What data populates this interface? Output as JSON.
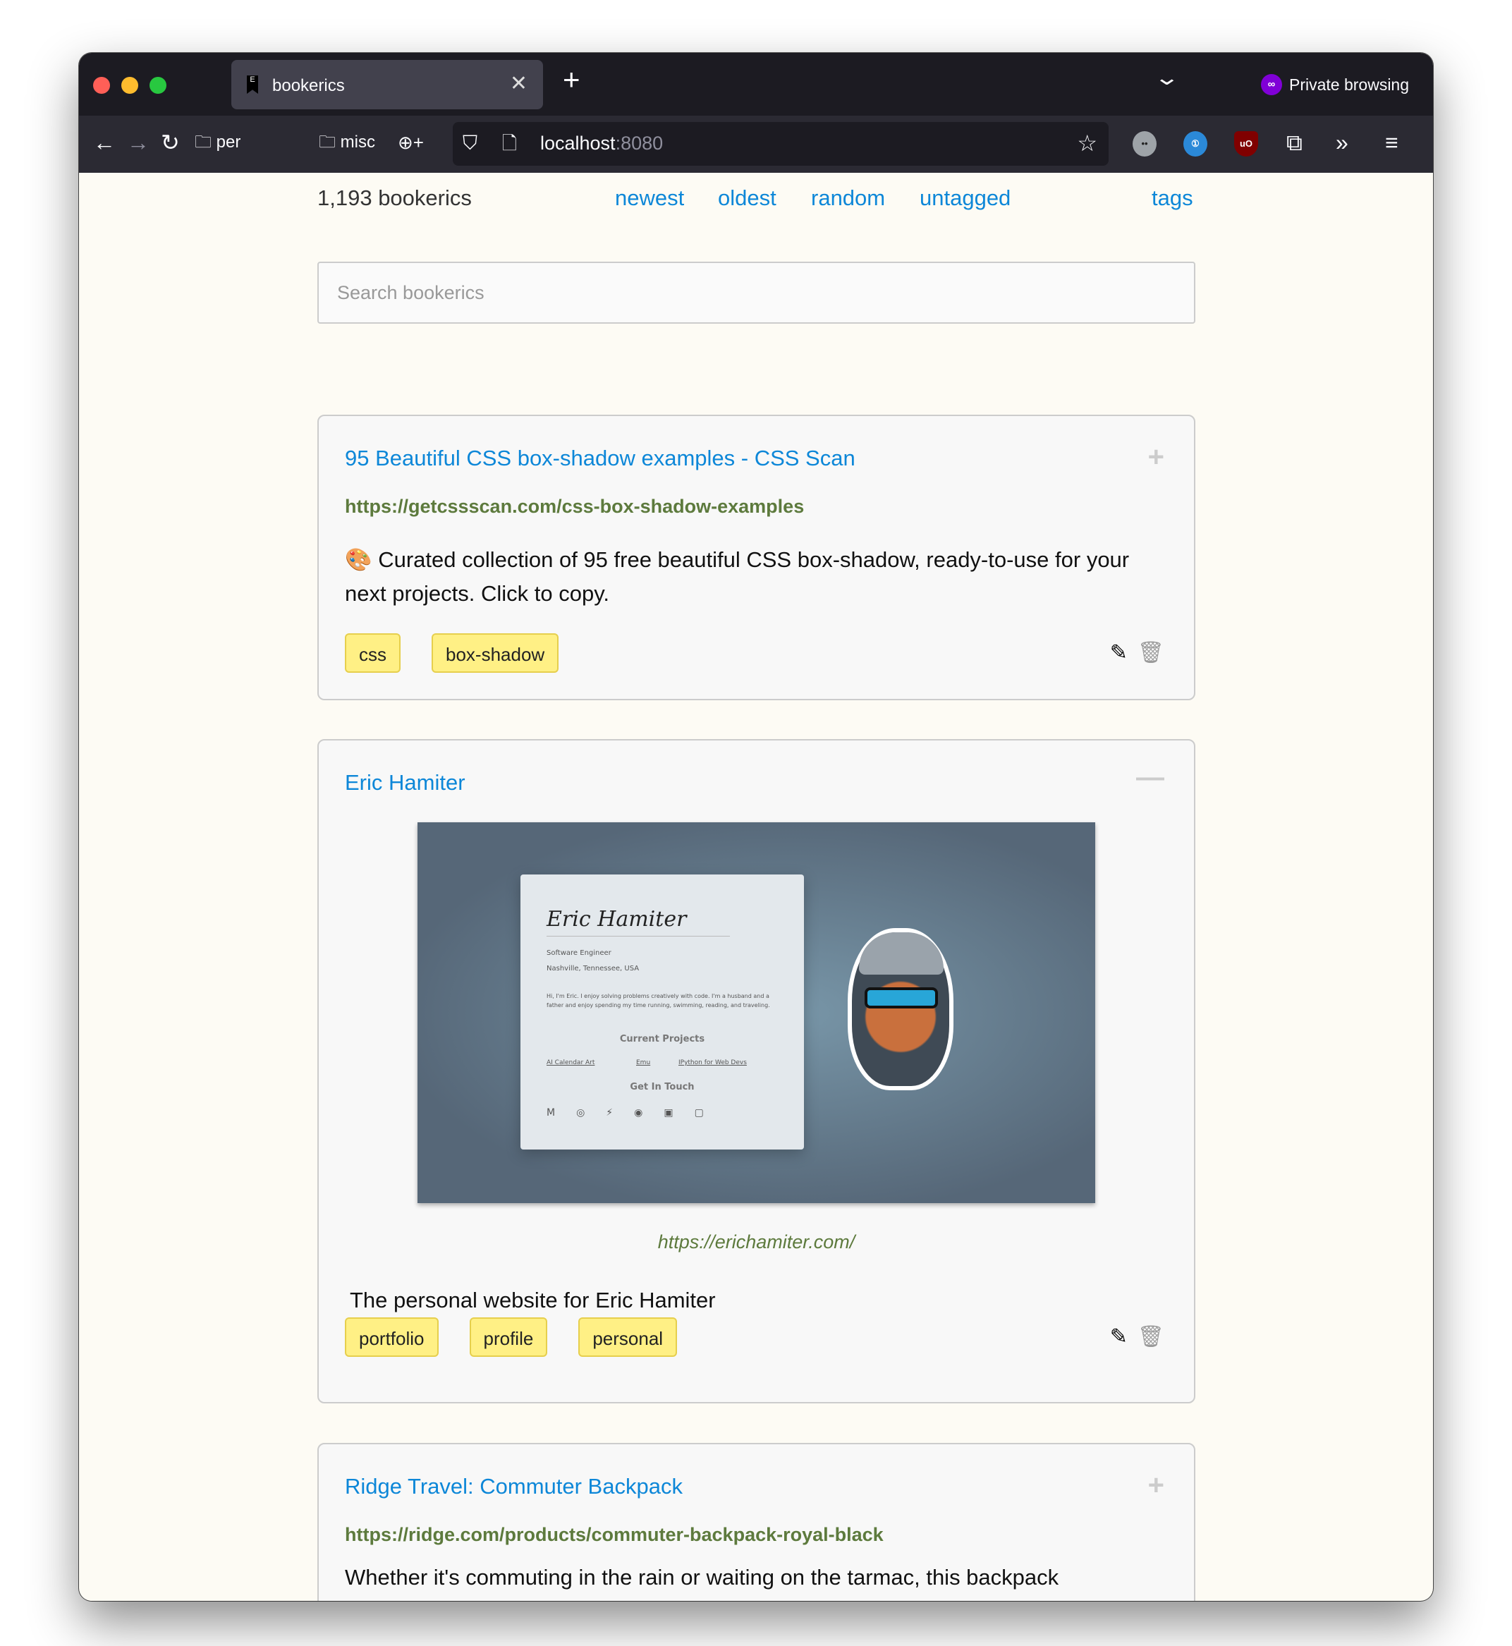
{
  "browser": {
    "tab_title": "bookerics",
    "private_label": "Private browsing",
    "url_host": "localhost",
    "url_port": ":8080",
    "bookmarks": [
      "per",
      "misc"
    ],
    "bookmark_add": "+"
  },
  "header": {
    "count": "1,193 bookerics",
    "nav": [
      "newest",
      "oldest",
      "random",
      "untagged",
      "tags"
    ]
  },
  "search": {
    "placeholder": "Search bookerics",
    "value": ""
  },
  "colors": {
    "link": "#0d87d8",
    "url": "#5d7a3d",
    "tag_bg": "#fff085"
  },
  "cards": [
    {
      "title": "95 Beautiful CSS box-shadow examples - CSS Scan",
      "url": "https://getcssscan.com/css-box-shadow-examples",
      "description": "🎨 Curated collection of 95 free beautiful CSS box-shadow, ready-to-use for your next projects. Click to copy.",
      "tags": [
        "css",
        "box-shadow"
      ],
      "toggle": "+"
    },
    {
      "title": "Eric Hamiter",
      "url": "https://erichamiter.com/",
      "description": "The personal website for Eric Hamiter",
      "tags": [
        "portfolio",
        "profile",
        "personal"
      ],
      "toggle": "—",
      "preview": {
        "name": "Eric Hamiter",
        "role": "Software Engineer",
        "location": "Nashville, Tennessee, USA",
        "bio": "Hi, I'm Eric. I enjoy solving problems creatively with code. I'm a husband and a father and enjoy spending my time running, swimming, reading, and traveling.",
        "projects_heading": "Current Projects",
        "projects": [
          "AI Calendar Art",
          "Emu",
          "IPython for Web Devs"
        ],
        "contact_heading": "Get In Touch"
      }
    },
    {
      "title": "Ridge Travel: Commuter Backpack",
      "url": "https://ridge.com/products/commuter-backpack-royal-black",
      "description": "Whether it's commuting in the rain or waiting on the tarmac, this backpack",
      "toggle": "+"
    }
  ]
}
